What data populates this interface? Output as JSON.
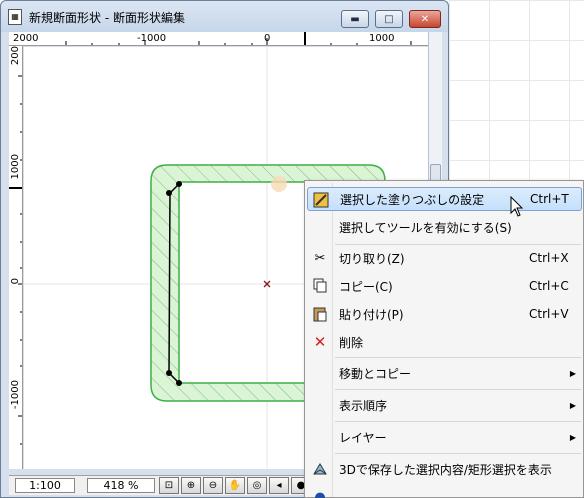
{
  "window": {
    "title": "新規断面形状 - 断面形状編集",
    "minimize_glyph": "▬",
    "maximize_glyph": "□",
    "close_glyph": "✕"
  },
  "ruler_top": {
    "labels": [
      "2000",
      "-1000",
      "0",
      "1000"
    ]
  },
  "ruler_left": {
    "labels": [
      "200",
      "1000",
      "0",
      "-1000"
    ]
  },
  "statusbar": {
    "scale": "1:100",
    "zoom": "418 %"
  },
  "context_menu": {
    "items": [
      {
        "label": "選択した塗りつぶしの設定",
        "shortcut": "Ctrl+T",
        "icon": "fill-settings-icon"
      },
      {
        "label": "選択してツールを有効にする(S)",
        "shortcut": "",
        "icon": ""
      },
      {
        "label": "切り取り(Z)",
        "shortcut": "Ctrl+X",
        "icon": "scissors-icon"
      },
      {
        "label": "コピー(C)",
        "shortcut": "Ctrl+C",
        "icon": "copy-icon"
      },
      {
        "label": "貼り付け(P)",
        "shortcut": "Ctrl+V",
        "icon": "paste-icon"
      },
      {
        "label": "削除",
        "shortcut": "",
        "icon": "delete-icon"
      },
      {
        "label": "移動とコピー",
        "shortcut": "",
        "icon": ""
      },
      {
        "label": "表示順序",
        "shortcut": "",
        "icon": ""
      },
      {
        "label": "レイヤー",
        "shortcut": "",
        "icon": ""
      },
      {
        "label": "3Dで保存した選択内容/矩形選択を表示",
        "shortcut": "",
        "icon": "3d-view-icon"
      }
    ]
  },
  "colors": {
    "fill_green": "#d9f5d3",
    "outline_green": "#3cb043",
    "menu_highlight": "#c4e0fc",
    "delete_red": "#d62020"
  }
}
